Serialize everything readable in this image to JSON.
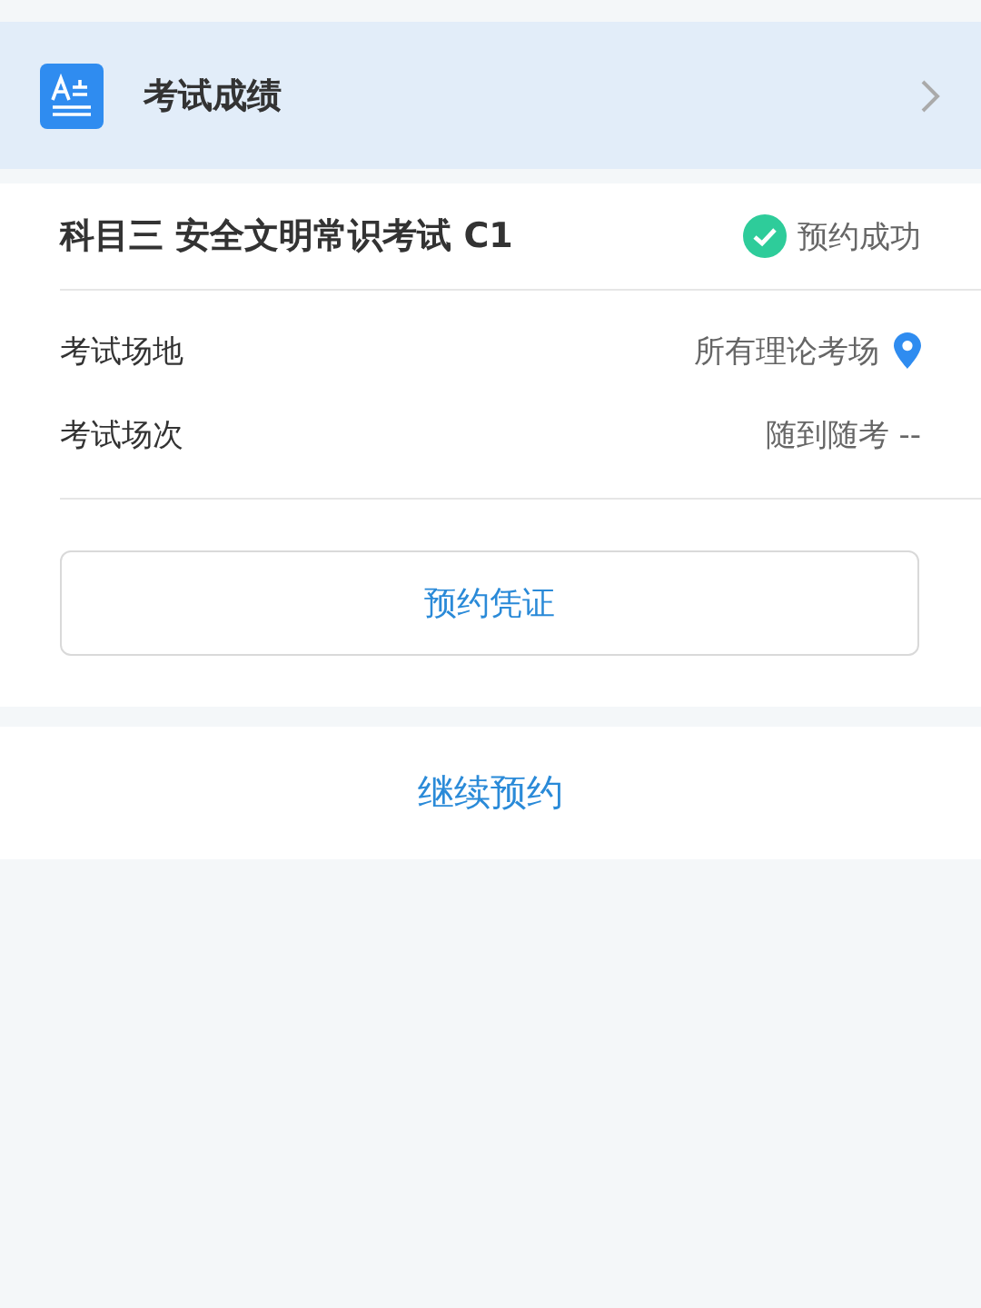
{
  "header": {
    "title": "考试成绩"
  },
  "exam": {
    "title": "科目三 安全文明常识考试 C1",
    "status": "预约成功",
    "rows": [
      {
        "label": "考试场地",
        "value": "所有理论考场",
        "kind": "location"
      },
      {
        "label": "考试场次",
        "value": "随到随考 --",
        "kind": "plain"
      }
    ],
    "button": "预约凭证"
  },
  "continue_link": "继续预约"
}
